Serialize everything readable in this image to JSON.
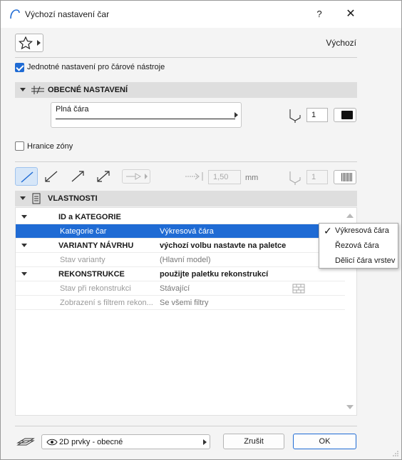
{
  "window": {
    "title": "Výchozí nastavení čar",
    "help_label": "?",
    "close_label": "✕"
  },
  "top": {
    "preset_name": "Výchozí"
  },
  "unified_setting": {
    "label": "Jednotné nastavení pro čárové nástroje",
    "checked": true
  },
  "general": {
    "header": "OBECNÉ NASTAVENÍ",
    "line_type": "Plná čára",
    "pen_number": "1",
    "pen_color": "#111111"
  },
  "zone_boundary": {
    "label": "Hranice zóny",
    "checked": false
  },
  "tools_row": {
    "length_value": "1,50",
    "length_unit": "mm",
    "pen_number": "1"
  },
  "properties": {
    "header": "VLASTNOSTI",
    "rows": [
      {
        "type": "group",
        "name": "ID a KATEGORIE",
        "value": ""
      },
      {
        "type": "selected",
        "name": "Kategorie čar",
        "value": "Výkresová čára"
      },
      {
        "type": "group",
        "name": "VARIANTY NÁVRHU",
        "value": "výchozí volbu nastavte na paletce"
      },
      {
        "type": "sub",
        "name": "Stav varianty",
        "value": "(Hlavní model)"
      },
      {
        "type": "group",
        "name": "REKONSTRUKCE",
        "value": "použijte paletku rekonstrukcí"
      },
      {
        "type": "sub",
        "name": "Stav při rekonstrukci",
        "value": "Stávající"
      },
      {
        "type": "sub",
        "name": "Zobrazení s filtrem rekon...",
        "value": "Se všemi filtry"
      }
    ]
  },
  "category_popup": {
    "options": [
      "Výkresová čára",
      "Řezová čára",
      "Dělicí čára vrstev"
    ],
    "selected_index": 0
  },
  "footer": {
    "view_label": "2D prvky - obecné",
    "cancel_label": "Zrušit",
    "ok_label": "OK"
  },
  "colors": {
    "accent": "#1f6bd4",
    "section_bg": "#dedede",
    "dialog_bg": "#f4f4f4"
  }
}
